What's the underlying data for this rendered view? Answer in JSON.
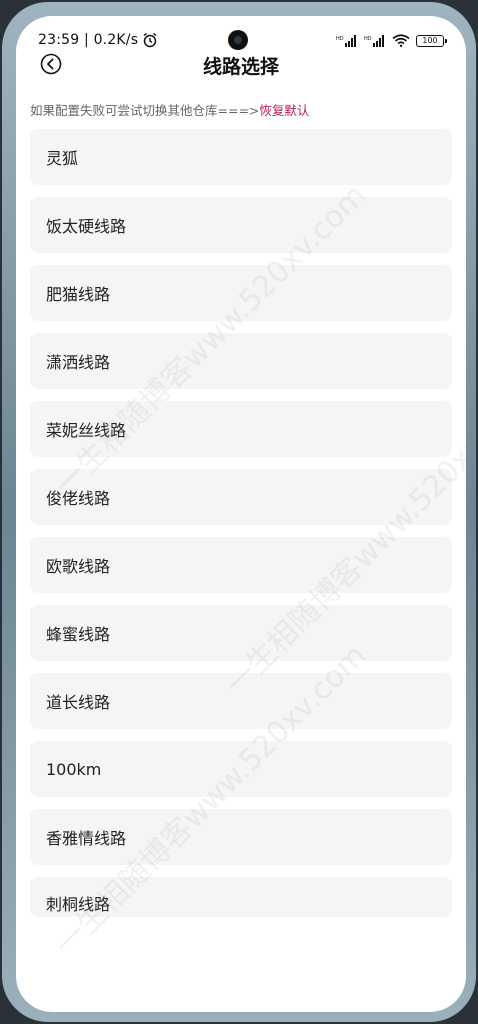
{
  "status_bar": {
    "time": "23:59 | 0.2K/s",
    "alarm_icon": "alarm-clock-icon",
    "signal_label_1": "HD",
    "signal_label_2": "HD",
    "battery": "100"
  },
  "header": {
    "back_icon": "back-arrow-circle-icon",
    "title": "线路选择"
  },
  "hint": {
    "text": "如果配置失败可尝试切换其他仓库===>",
    "restore_label": "恢复默认"
  },
  "routes": [
    {
      "label": "灵狐"
    },
    {
      "label": "饭太硬线路"
    },
    {
      "label": "肥猫线路"
    },
    {
      "label": "潇洒线路"
    },
    {
      "label": "菜妮丝线路"
    },
    {
      "label": "俊佬线路"
    },
    {
      "label": "欧歌线路"
    },
    {
      "label": "蜂蜜线路"
    },
    {
      "label": "道长线路"
    },
    {
      "label": "100km"
    },
    {
      "label": "香雅情线路"
    },
    {
      "label": "刺桐线路"
    }
  ],
  "watermark": {
    "text": "一生相随博客www.520xv.com"
  },
  "colors": {
    "accent": "#c2185b",
    "item_bg": "#f5f5f5",
    "hint_text": "#666666"
  }
}
